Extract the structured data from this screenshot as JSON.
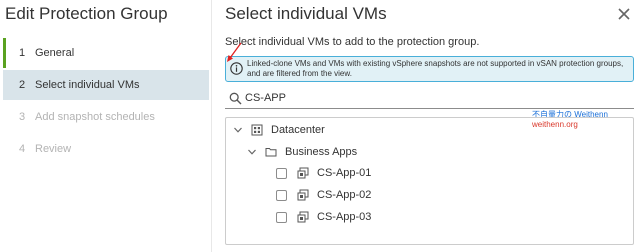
{
  "wizard": {
    "title": "Edit Protection Group",
    "steps": [
      {
        "num": "1",
        "label": "General",
        "state": "completed"
      },
      {
        "num": "2",
        "label": "Select individual VMs",
        "state": "active"
      },
      {
        "num": "3",
        "label": "Add snapshot schedules",
        "state": "disabled"
      },
      {
        "num": "4",
        "label": "Review",
        "state": "disabled"
      }
    ]
  },
  "main": {
    "title": "Select individual VMs",
    "subtitle": "Select individual VMs to add to the protection group.",
    "info_message": "Linked-clone VMs and VMs with existing vSphere snapshots are not supported in vSAN protection groups, and are filtered from the view.",
    "search": {
      "value": "CS-APP",
      "placeholder": ""
    },
    "tree": {
      "datacenter": "Datacenter",
      "folder": "Business Apps",
      "vms": [
        "CS-App-01",
        "CS-App-02",
        "CS-App-03"
      ]
    }
  },
  "watermark": {
    "line1_zh": "不自量力",
    "line1_mid": "の",
    "line1_name": "Weithenn",
    "line2": "weithenn.org"
  },
  "colors": {
    "accent_green": "#5aa220",
    "active_step_bg": "#d9e4ea",
    "info_bg": "#e1f1f6",
    "info_border": "#49afd9",
    "annotation_red": "#e02020"
  },
  "icons": [
    "info-icon",
    "search-icon",
    "close-icon",
    "chevron-down-icon",
    "datacenter-icon",
    "folder-icon",
    "vm-icon"
  ]
}
